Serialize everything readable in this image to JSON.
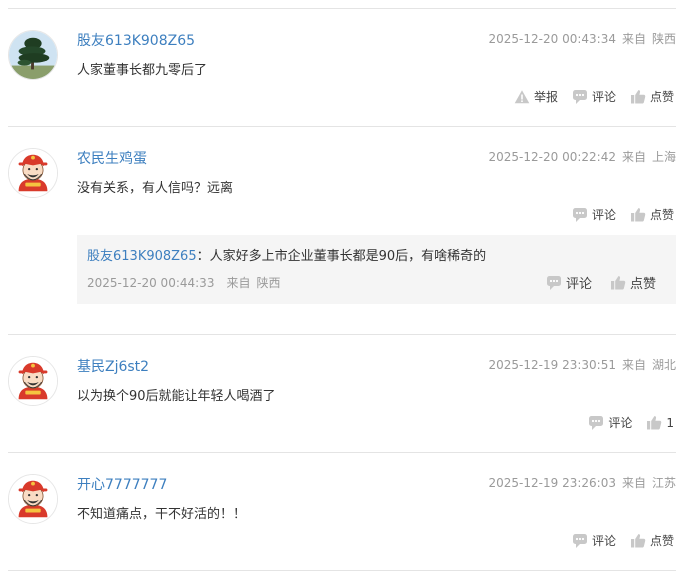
{
  "comments": [
    {
      "username": "股友613K908Z65",
      "time": "2025-12-20 00:43:34",
      "from": "来自",
      "location": "陕西",
      "text": "人家董事长都九零后了",
      "avatar": "pine-tree-avatar",
      "actions": {
        "report": "举报",
        "comment": "评论",
        "like": "点赞"
      }
    },
    {
      "username": "农民生鸡蛋",
      "time": "2025-12-20 00:22:42",
      "from": "来自",
      "location": "上海",
      "text": "没有关系，有人信吗？远离",
      "avatar": "fortune-god-avatar",
      "actions": {
        "comment": "评论",
        "like": "点赞"
      },
      "reply": {
        "username": "股友613K908Z65",
        "colon": "：",
        "text": "人家好多上市企业董事长都是90后，有啥稀奇的",
        "time": "2025-12-20 00:44:33",
        "from": "来自",
        "location": "陕西",
        "actions": {
          "comment": "评论",
          "like": "点赞"
        }
      }
    },
    {
      "username": "基民Zj6st2",
      "time": "2025-12-19 23:30:51",
      "from": "来自",
      "location": "湖北",
      "text": "以为换个90后就能让年轻人喝酒了",
      "avatar": "fortune-god-avatar",
      "actions": {
        "comment": "评论",
        "like": "1"
      }
    },
    {
      "username": "开心7777777",
      "time": "2025-12-19 23:26:03",
      "from": "来自",
      "location": "江苏",
      "text": "不知道痛点，干不好活的！！",
      "avatar": "fortune-god-avatar",
      "actions": {
        "comment": "评论",
        "like": "点赞"
      }
    }
  ],
  "colors": {
    "username": "#3d7fbf",
    "meta": "#9a9a9a",
    "text": "#333333",
    "divider": "#e4e4e4",
    "reply_bg": "#f5f5f5",
    "icon": "#c8c8c8"
  }
}
